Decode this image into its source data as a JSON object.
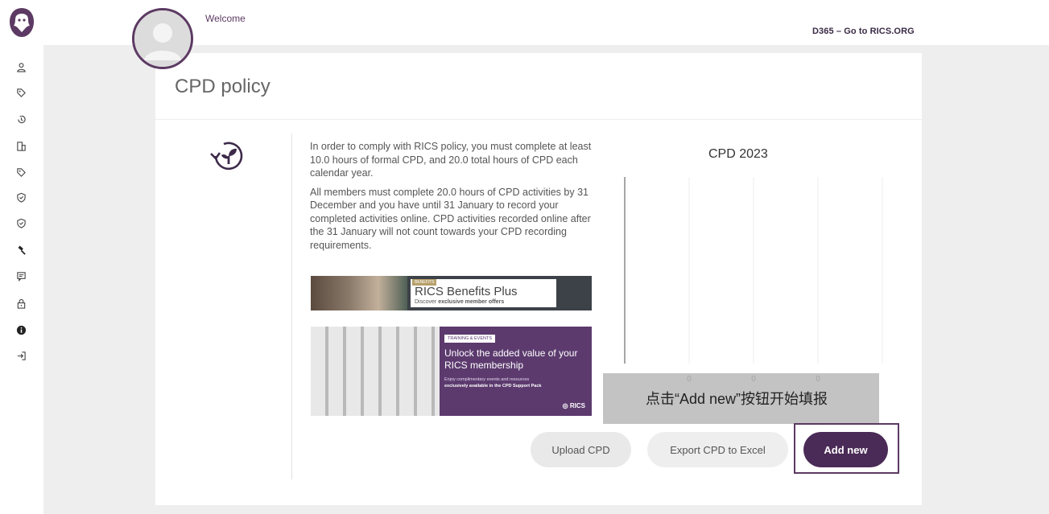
{
  "header": {
    "welcome": "Welcome",
    "d365_link": "D365 – Go to RICS.ORG"
  },
  "page": {
    "title": "CPD policy"
  },
  "sidebar": {
    "items": [
      {
        "icon": "user-icon"
      },
      {
        "icon": "tag-icon"
      },
      {
        "icon": "history-icon"
      },
      {
        "icon": "building-icon"
      },
      {
        "icon": "tag-icon"
      },
      {
        "icon": "shield-check-icon"
      },
      {
        "icon": "shield-check-icon"
      },
      {
        "icon": "gavel-icon"
      },
      {
        "icon": "message-icon"
      },
      {
        "icon": "lock-icon"
      },
      {
        "icon": "info-icon"
      },
      {
        "icon": "sign-out-icon"
      }
    ]
  },
  "policy": {
    "paragraph1": "In order to comply with RICS policy, you must complete at least 10.0 hours of formal CPD, and 20.0 total hours of CPD each calendar year.",
    "paragraph2": "All members must complete 20.0 hours of CPD activities by 31 December and you have until 31 January to record your completed activities online. CPD activities recorded online after the 31 January will not count towards your CPD recording requirements."
  },
  "banner1": {
    "tag": "BENEFITS",
    "title": "RICS Benefits Plus",
    "subtitle_prefix": "Discover",
    "subtitle_bold": "exclusive member offers"
  },
  "banner2": {
    "tag": "TRAINING & EVENTS",
    "title": "Unlock the added value of your RICS membership",
    "sub1": "Enjoy complimentary events and resources",
    "sub2": "exclusively available in the CPD Support Pack",
    "logo": "RICS"
  },
  "chart_data": {
    "type": "bar",
    "title": "CPD 2023",
    "categories": [
      "",
      "",
      ""
    ],
    "values": [
      0,
      0,
      0
    ],
    "grid": true
  },
  "overlay": {
    "text": "点击“Add new”按钮开始填报"
  },
  "actions": {
    "upload": "Upload CPD",
    "export": "Export CPD to Excel",
    "add": "Add new"
  },
  "colors": {
    "brand": "#5c3a63",
    "button_primary": "#4a2a56"
  }
}
